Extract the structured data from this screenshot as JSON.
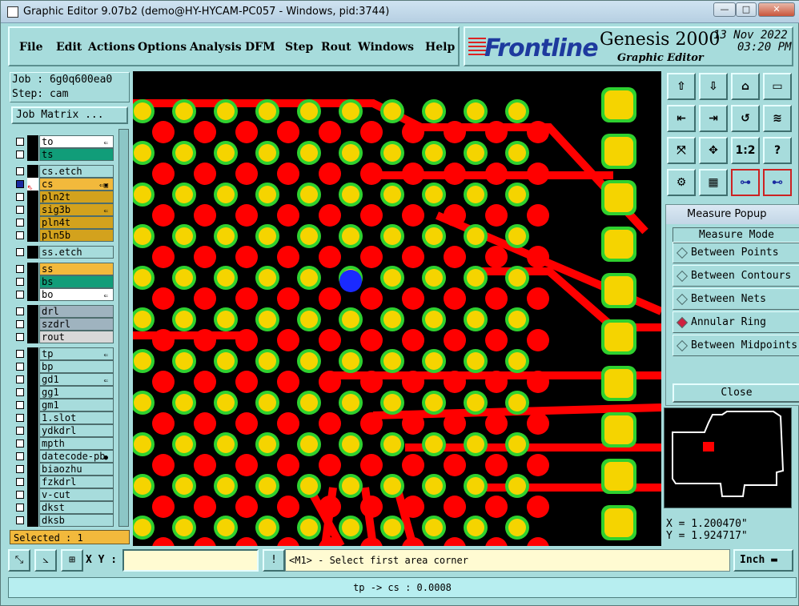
{
  "window": {
    "title": "Graphic Editor 9.07b2 (demo@HY-HYCAM-PC057 - Windows, pid:3744)"
  },
  "menu": [
    "File",
    "Edit",
    "Actions",
    "Options",
    "Analysis",
    "DFM",
    "Step",
    "Rout",
    "Windows",
    "Help"
  ],
  "brand": {
    "logo": "Frontline",
    "product": "Genesis 2000",
    "sub": "Graphic Editor",
    "date": "13 Nov 2022",
    "time": "03:20 PM"
  },
  "job": {
    "job_label": "Job : 6g0q600ea0",
    "step_label": "Step: cam",
    "matrix_button": "Job Matrix ..."
  },
  "layers": [
    {
      "name": "to",
      "color": "#ffffff",
      "flag": "⇐"
    },
    {
      "name": "ts",
      "color": "#119d79",
      "flag": ""
    },
    {
      "name": "cs.etch",
      "color": "#a7dcdc",
      "flag": ""
    },
    {
      "name": "cs",
      "color": "#f2b93c",
      "flag": "⇐▣",
      "active": true
    },
    {
      "name": "pln2t",
      "color": "#d3a21d",
      "flag": ""
    },
    {
      "name": "sig3b",
      "color": "#d3a21d",
      "flag": "⇐"
    },
    {
      "name": "pln4t",
      "color": "#d3a21d",
      "flag": ""
    },
    {
      "name": "pln5b",
      "color": "#d3a21d",
      "flag": ""
    },
    {
      "name": "ss.etch",
      "color": "#a7dcdc",
      "flag": ""
    },
    {
      "name": "ss",
      "color": "#f2b93c",
      "flag": ""
    },
    {
      "name": "bs",
      "color": "#119d79",
      "flag": ""
    },
    {
      "name": "bo",
      "color": "#ffffff",
      "flag": "⇐"
    },
    {
      "name": "drl",
      "color": "#9fb3bf",
      "flag": ""
    },
    {
      "name": "szdrl",
      "color": "#9fb3bf",
      "flag": ""
    },
    {
      "name": "rout",
      "color": "#d8d8d8",
      "flag": ""
    },
    {
      "name": "tp",
      "color": "#a7dcdc",
      "flag": "⇐"
    },
    {
      "name": "bp",
      "color": "#a7dcdc",
      "flag": ""
    },
    {
      "name": "gd1",
      "color": "#a7dcdc",
      "flag": "⇐"
    },
    {
      "name": "gg1",
      "color": "#a7dcdc",
      "flag": ""
    },
    {
      "name": "gm1",
      "color": "#a7dcdc",
      "flag": ""
    },
    {
      "name": "1.slot",
      "color": "#a7dcdc",
      "flag": ""
    },
    {
      "name": "ydkdrl",
      "color": "#a7dcdc",
      "flag": ""
    },
    {
      "name": "mpth",
      "color": "#a7dcdc",
      "flag": ""
    },
    {
      "name": "datecode-pb",
      "color": "#a7dcdc",
      "flag": "●"
    },
    {
      "name": "biaozhu",
      "color": "#a7dcdc",
      "flag": ""
    },
    {
      "name": "fzkdrl",
      "color": "#a7dcdc",
      "flag": ""
    },
    {
      "name": "v-cut",
      "color": "#a7dcdc",
      "flag": ""
    },
    {
      "name": "dkst",
      "color": "#a7dcdc",
      "flag": ""
    },
    {
      "name": "dksb",
      "color": "#a7dcdc",
      "flag": ""
    }
  ],
  "selected": "Selected : 1",
  "measure": {
    "title": "Measure Popup",
    "mode_label": "Measure Mode",
    "options": [
      "Between Points",
      "Between Contours",
      "Between Nets",
      "Annular Ring",
      "Between Midpoints"
    ],
    "selected_option": "Annular Ring",
    "close": "Close"
  },
  "coords": {
    "x": "X = 1.200470\"",
    "y": "Y = 1.924717\""
  },
  "input": {
    "xy_label": "X Y :",
    "xy_value": "",
    "prompt": "<M1> - Select first area corner",
    "units": "Inch"
  },
  "status": "tp -> cs : 0.0008",
  "colors": {
    "pad": "#f5d400",
    "pad_ring": "#2fd12f",
    "trace": "#ff0000",
    "highlight": "#1a2aff",
    "board": "#000000"
  }
}
